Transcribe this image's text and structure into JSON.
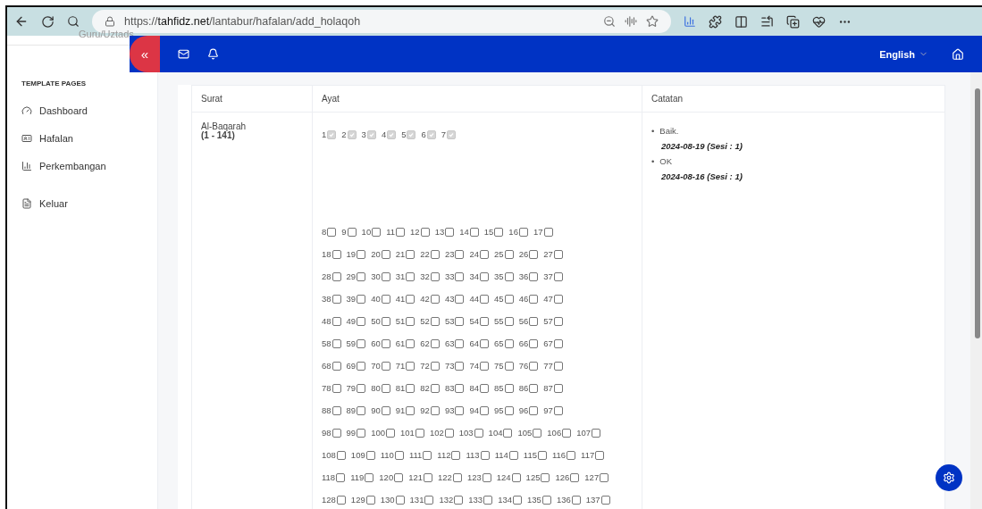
{
  "browser": {
    "url": "https://**tahfidz.net**/lantabur/hafalan/add_holaqoh"
  },
  "sidebar": {
    "user_role": "Guru/Uztads",
    "section": "TEMPLATE PAGES",
    "items": [
      {
        "label": "Dashboard",
        "selected": false
      },
      {
        "label": "Hafalan",
        "selected": false
      },
      {
        "label": "Perkembangan",
        "selected": false
      },
      {
        "label": "Keluar",
        "selected": false
      }
    ]
  },
  "topbar": {
    "collapse": "«",
    "language": "English"
  },
  "table": {
    "columns": [
      "Surat",
      "Ayat",
      "Catatan"
    ],
    "surat": {
      "name": "Al-Baqarah",
      "range": "(1 - 141)"
    },
    "ayat_rows": [
      [
        {
          "label": "1",
          "checked": true,
          "disabled": true
        },
        {
          "label": "2",
          "checked": true,
          "disabled": true
        },
        {
          "label": "3",
          "checked": true,
          "disabled": true
        },
        {
          "label": "4",
          "checked": true,
          "disabled": true
        },
        {
          "label": "5",
          "checked": true,
          "disabled": true
        },
        {
          "label": "6",
          "checked": true,
          "disabled": true
        },
        {
          "label": "7",
          "checked": true,
          "disabled": true
        }
      ],
      [
        {
          "label": "8",
          "checked": false,
          "disabled": false
        },
        {
          "label": "9",
          "checked": false,
          "disabled": false
        },
        {
          "label": "10",
          "checked": false,
          "disabled": false
        },
        {
          "label": "11",
          "checked": false,
          "disabled": false
        },
        {
          "label": "12",
          "checked": false,
          "disabled": false
        },
        {
          "label": "13",
          "checked": false,
          "disabled": false
        },
        {
          "label": "14",
          "checked": false,
          "disabled": false
        },
        {
          "label": "15",
          "checked": false,
          "disabled": false
        },
        {
          "label": "16",
          "checked": false,
          "disabled": false
        },
        {
          "label": "17",
          "checked": false,
          "disabled": false
        }
      ],
      [
        {
          "label": "18",
          "checked": false,
          "disabled": false
        },
        {
          "label": "19",
          "checked": false,
          "disabled": false
        },
        {
          "label": "20",
          "checked": false,
          "disabled": false
        },
        {
          "label": "21",
          "checked": false,
          "disabled": false
        },
        {
          "label": "22",
          "checked": false,
          "disabled": false
        },
        {
          "label": "23",
          "checked": false,
          "disabled": false
        },
        {
          "label": "24",
          "checked": false,
          "disabled": false
        },
        {
          "label": "25",
          "checked": false,
          "disabled": false
        },
        {
          "label": "26",
          "checked": false,
          "disabled": false
        },
        {
          "label": "27",
          "checked": false,
          "disabled": false
        }
      ],
      [
        {
          "label": "28",
          "checked": false,
          "disabled": false
        },
        {
          "label": "29",
          "checked": false,
          "disabled": false
        },
        {
          "label": "30",
          "checked": false,
          "disabled": false
        },
        {
          "label": "31",
          "checked": false,
          "disabled": false
        },
        {
          "label": "32",
          "checked": false,
          "disabled": false
        },
        {
          "label": "33",
          "checked": false,
          "disabled": false
        },
        {
          "label": "34",
          "checked": false,
          "disabled": false
        },
        {
          "label": "35",
          "checked": false,
          "disabled": false
        },
        {
          "label": "36",
          "checked": false,
          "disabled": false
        },
        {
          "label": "37",
          "checked": false,
          "disabled": false
        }
      ],
      [
        {
          "label": "38",
          "checked": false,
          "disabled": false
        },
        {
          "label": "39",
          "checked": false,
          "disabled": false
        },
        {
          "label": "40",
          "checked": false,
          "disabled": false
        },
        {
          "label": "41",
          "checked": false,
          "disabled": false
        },
        {
          "label": "42",
          "checked": false,
          "disabled": false
        },
        {
          "label": "43",
          "checked": false,
          "disabled": false
        },
        {
          "label": "44",
          "checked": false,
          "disabled": false
        },
        {
          "label": "45",
          "checked": false,
          "disabled": false
        },
        {
          "label": "46",
          "checked": false,
          "disabled": false
        },
        {
          "label": "47",
          "checked": false,
          "disabled": false
        }
      ],
      [
        {
          "label": "48",
          "checked": false,
          "disabled": false
        },
        {
          "label": "49",
          "checked": false,
          "disabled": false
        },
        {
          "label": "50",
          "checked": false,
          "disabled": false
        },
        {
          "label": "51",
          "checked": false,
          "disabled": false
        },
        {
          "label": "52",
          "checked": false,
          "disabled": false
        },
        {
          "label": "53",
          "checked": false,
          "disabled": false
        },
        {
          "label": "54",
          "checked": false,
          "disabled": false
        },
        {
          "label": "55",
          "checked": false,
          "disabled": false
        },
        {
          "label": "56",
          "checked": false,
          "disabled": false
        },
        {
          "label": "57",
          "checked": false,
          "disabled": false
        }
      ],
      [
        {
          "label": "58",
          "checked": false,
          "disabled": false
        },
        {
          "label": "59",
          "checked": false,
          "disabled": false
        },
        {
          "label": "60",
          "checked": false,
          "disabled": false
        },
        {
          "label": "61",
          "checked": false,
          "disabled": false
        },
        {
          "label": "62",
          "checked": false,
          "disabled": false
        },
        {
          "label": "63",
          "checked": false,
          "disabled": false
        },
        {
          "label": "64",
          "checked": false,
          "disabled": false
        },
        {
          "label": "65",
          "checked": false,
          "disabled": false
        },
        {
          "label": "66",
          "checked": false,
          "disabled": false
        },
        {
          "label": "67",
          "checked": false,
          "disabled": false
        }
      ],
      [
        {
          "label": "68",
          "checked": false,
          "disabled": false
        },
        {
          "label": "69",
          "checked": false,
          "disabled": false
        },
        {
          "label": "70",
          "checked": false,
          "disabled": false
        },
        {
          "label": "71",
          "checked": false,
          "disabled": false
        },
        {
          "label": "72",
          "checked": false,
          "disabled": false
        },
        {
          "label": "73",
          "checked": false,
          "disabled": false
        },
        {
          "label": "74",
          "checked": false,
          "disabled": false
        },
        {
          "label": "75",
          "checked": false,
          "disabled": false
        },
        {
          "label": "76",
          "checked": false,
          "disabled": false
        },
        {
          "label": "77",
          "checked": false,
          "disabled": false
        }
      ],
      [
        {
          "label": "78",
          "checked": false,
          "disabled": false
        },
        {
          "label": "79",
          "checked": false,
          "disabled": false
        },
        {
          "label": "80",
          "checked": false,
          "disabled": false
        },
        {
          "label": "81",
          "checked": false,
          "disabled": false
        },
        {
          "label": "82",
          "checked": false,
          "disabled": false
        },
        {
          "label": "83",
          "checked": false,
          "disabled": false
        },
        {
          "label": "84",
          "checked": false,
          "disabled": false
        },
        {
          "label": "85",
          "checked": false,
          "disabled": false
        },
        {
          "label": "86",
          "checked": false,
          "disabled": false
        },
        {
          "label": "87",
          "checked": false,
          "disabled": false
        }
      ],
      [
        {
          "label": "88",
          "checked": false,
          "disabled": false
        },
        {
          "label": "89",
          "checked": false,
          "disabled": false
        },
        {
          "label": "90",
          "checked": false,
          "disabled": false
        },
        {
          "label": "91",
          "checked": false,
          "disabled": false
        },
        {
          "label": "92",
          "checked": false,
          "disabled": false
        },
        {
          "label": "93",
          "checked": false,
          "disabled": false
        },
        {
          "label": "94",
          "checked": false,
          "disabled": false
        },
        {
          "label": "95",
          "checked": false,
          "disabled": false
        },
        {
          "label": "96",
          "checked": false,
          "disabled": false
        },
        {
          "label": "97",
          "checked": false,
          "disabled": false
        }
      ],
      [
        {
          "label": "98",
          "checked": false,
          "disabled": false
        },
        {
          "label": "99",
          "checked": false,
          "disabled": false
        },
        {
          "label": "100",
          "checked": false,
          "disabled": false
        },
        {
          "label": "101",
          "checked": false,
          "disabled": false
        },
        {
          "label": "102",
          "checked": false,
          "disabled": false
        },
        {
          "label": "103",
          "checked": false,
          "disabled": false
        },
        {
          "label": "104",
          "checked": false,
          "disabled": false
        },
        {
          "label": "105",
          "checked": false,
          "disabled": false
        },
        {
          "label": "106",
          "checked": false,
          "disabled": false
        },
        {
          "label": "107",
          "checked": false,
          "disabled": false
        }
      ],
      [
        {
          "label": "108",
          "checked": false,
          "disabled": false
        },
        {
          "label": "109",
          "checked": false,
          "disabled": false
        },
        {
          "label": "110",
          "checked": false,
          "disabled": false
        },
        {
          "label": "111",
          "checked": false,
          "disabled": false
        },
        {
          "label": "112",
          "checked": false,
          "disabled": false
        },
        {
          "label": "113",
          "checked": false,
          "disabled": false
        },
        {
          "label": "114",
          "checked": false,
          "disabled": false
        },
        {
          "label": "115",
          "checked": false,
          "disabled": false
        },
        {
          "label": "116",
          "checked": false,
          "disabled": false
        },
        {
          "label": "117",
          "checked": false,
          "disabled": false
        }
      ],
      [
        {
          "label": "118",
          "checked": false,
          "disabled": false
        },
        {
          "label": "119",
          "checked": false,
          "disabled": false
        },
        {
          "label": "120",
          "checked": false,
          "disabled": false
        },
        {
          "label": "121",
          "checked": false,
          "disabled": false
        },
        {
          "label": "122",
          "checked": false,
          "disabled": false
        },
        {
          "label": "123",
          "checked": false,
          "disabled": false
        },
        {
          "label": "124",
          "checked": false,
          "disabled": false
        },
        {
          "label": "125",
          "checked": false,
          "disabled": false
        },
        {
          "label": "126",
          "checked": false,
          "disabled": false
        },
        {
          "label": "127",
          "checked": false,
          "disabled": false
        }
      ],
      [
        {
          "label": "128",
          "checked": false,
          "disabled": false
        },
        {
          "label": "129",
          "checked": false,
          "disabled": false
        },
        {
          "label": "130",
          "checked": false,
          "disabled": false
        },
        {
          "label": "131",
          "checked": false,
          "disabled": false
        },
        {
          "label": "132",
          "checked": false,
          "disabled": false
        },
        {
          "label": "133",
          "checked": false,
          "disabled": false
        },
        {
          "label": "134",
          "checked": false,
          "disabled": false
        },
        {
          "label": "135",
          "checked": false,
          "disabled": false
        },
        {
          "label": "136",
          "checked": false,
          "disabled": false
        },
        {
          "label": "137",
          "checked": false,
          "disabled": false
        }
      ]
    ],
    "notes": [
      {
        "bullet": "•",
        "text": "Baik.",
        "date": "2024-08-19 (Sesi : 1)"
      },
      {
        "bullet": "•",
        "text": "OK",
        "date": "2024-08-16 (Sesi : 1)"
      }
    ]
  }
}
